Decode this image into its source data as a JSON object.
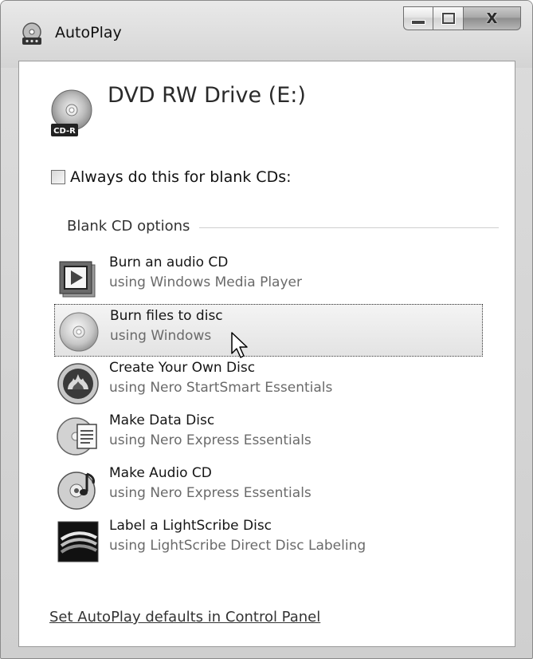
{
  "window": {
    "title": "AutoPlay",
    "title_icon": "autoplay-icon",
    "controls": {
      "minimize_icon": "minimize-icon",
      "maximize_icon": "maximize-icon",
      "close_icon": "close-icon",
      "close_glyph": "X"
    }
  },
  "device": {
    "name": "DVD RW Drive (E:)",
    "icon": "cd-r-drive-icon",
    "icon_badge": "CD-R"
  },
  "always_checkbox": {
    "label": "Always do this for blank CDs:",
    "checked": false
  },
  "group": {
    "label": "Blank CD options"
  },
  "options": [
    {
      "title": "Burn an audio CD",
      "subtitle": "using Windows Media Player",
      "icon": "media-player-icon",
      "selected": false
    },
    {
      "title": "Burn files to disc",
      "subtitle": "using Windows",
      "icon": "disc-icon",
      "selected": true
    },
    {
      "title": "Create Your Own Disc",
      "subtitle": "using Nero StartSmart Essentials",
      "icon": "nero-flame-icon",
      "selected": false
    },
    {
      "title": "Make Data Disc",
      "subtitle": "using Nero Express Essentials",
      "icon": "data-disc-icon",
      "selected": false
    },
    {
      "title": "Make Audio CD",
      "subtitle": "using Nero Express Essentials",
      "icon": "audio-disc-icon",
      "selected": false
    },
    {
      "title": "Label a LightScribe Disc",
      "subtitle": "using LightScribe Direct Disc Labeling",
      "icon": "lightscribe-icon",
      "selected": false
    }
  ],
  "footer_link": {
    "label": "Set AutoPlay defaults in Control Panel"
  },
  "colors": {
    "client_bg": "#ffffff",
    "frame": "#d4d4d4",
    "selection_bg": "#e8e8e8"
  }
}
